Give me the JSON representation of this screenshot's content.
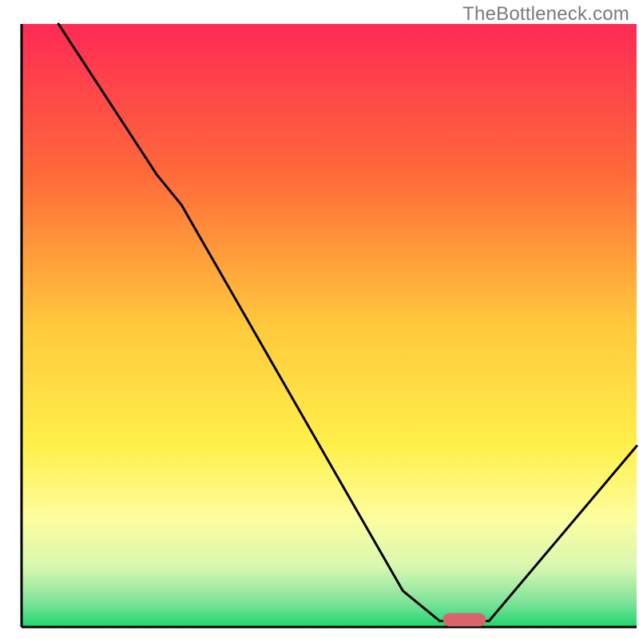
{
  "watermark": "TheBottleneck.com",
  "chart_data": {
    "type": "line",
    "title": "",
    "xlabel": "",
    "ylabel": "",
    "xlim": [
      0,
      100
    ],
    "ylim": [
      0,
      100
    ],
    "gradient_stops": [
      {
        "offset": 0,
        "color": "#ff2a55"
      },
      {
        "offset": 0.25,
        "color": "#ff6a3a"
      },
      {
        "offset": 0.5,
        "color": "#ffc93c"
      },
      {
        "offset": 0.7,
        "color": "#fff04a"
      },
      {
        "offset": 0.82,
        "color": "#fdfd9f"
      },
      {
        "offset": 0.9,
        "color": "#d9f7b0"
      },
      {
        "offset": 0.96,
        "color": "#7de39a"
      },
      {
        "offset": 1.0,
        "color": "#1ed66d"
      }
    ],
    "curve_points": [
      {
        "x": 6,
        "y": 100
      },
      {
        "x": 22,
        "y": 75
      },
      {
        "x": 26,
        "y": 70
      },
      {
        "x": 62,
        "y": 6
      },
      {
        "x": 68,
        "y": 1
      },
      {
        "x": 76,
        "y": 1
      },
      {
        "x": 100,
        "y": 30
      }
    ],
    "marker": {
      "x_center": 72,
      "y": 1.2,
      "width": 7,
      "height": 2.2,
      "color": "#d9646e"
    },
    "axes": {
      "left": {
        "x": 3,
        "y1": 0,
        "y2": 100
      },
      "bottom": {
        "y": 0,
        "x1": 3,
        "x2": 100
      }
    }
  }
}
